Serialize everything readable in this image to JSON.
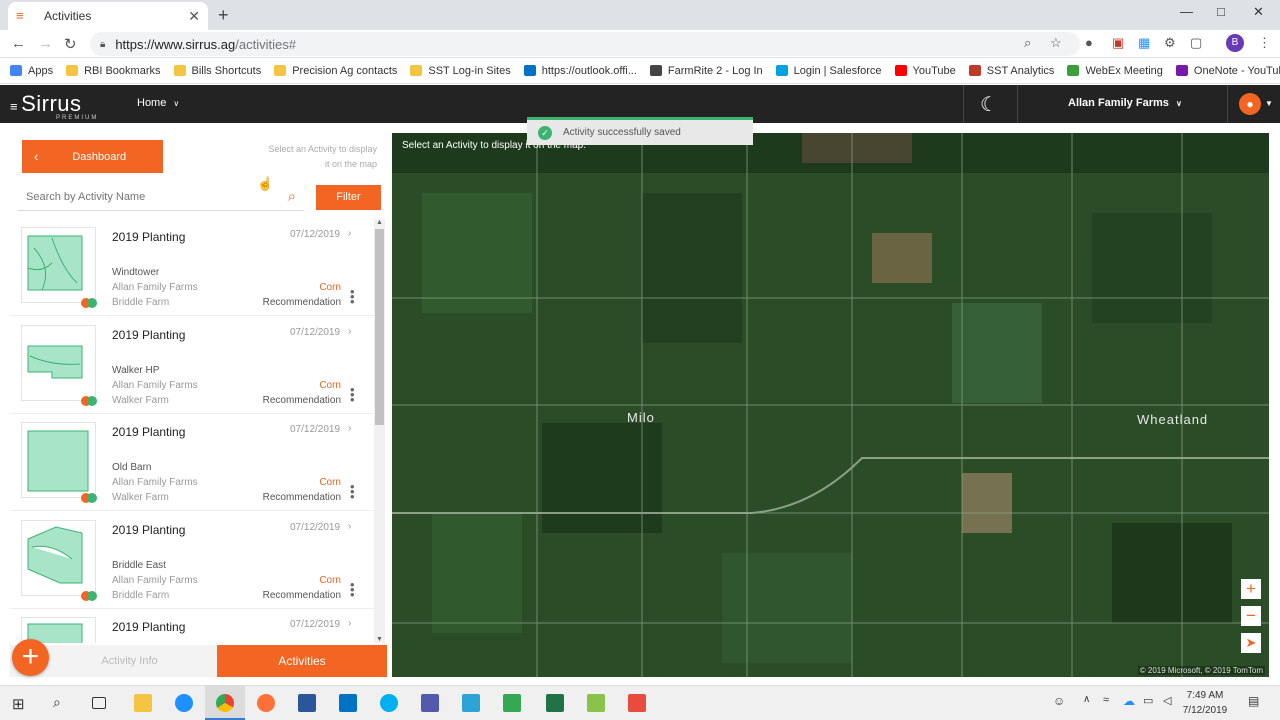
{
  "browser": {
    "tab_title": "Activities",
    "url_host": "https://www.sirrus.ag",
    "url_path": "/activities#",
    "profile_initial": "B",
    "bookmarks": [
      {
        "label": "Apps",
        "color": "#4285f4"
      },
      {
        "label": "RBI Bookmarks",
        "color": "#f4c542"
      },
      {
        "label": "Bills Shortcuts",
        "color": "#f4c542"
      },
      {
        "label": "Precision Ag contacts",
        "color": "#f4c542"
      },
      {
        "label": "SST Log-in Sites",
        "color": "#f4c542"
      },
      {
        "label": "https://outlook.offi...",
        "color": "#0072c6"
      },
      {
        "label": "FarmRite 2 - Log In",
        "color": "#444444"
      },
      {
        "label": "Login | Salesforce",
        "color": "#00a1e0"
      },
      {
        "label": "YouTube",
        "color": "#ff0000"
      },
      {
        "label": "SST Analytics",
        "color": "#c0392b"
      },
      {
        "label": "WebEx Meeting",
        "color": "#3aa13a"
      },
      {
        "label": "OneNote - YouTub...",
        "color": "#7719aa"
      }
    ]
  },
  "app": {
    "logo": "Sirrus",
    "logo_sub": "PREMIUM",
    "nav_home": "Home",
    "farm": "Allan Family Farms"
  },
  "panel": {
    "dashboard": "Dashboard",
    "hint": "Select an Activity to display it on the map",
    "search_placeholder": "Search by Activity Name",
    "filter": "Filter",
    "tab_info": "Activity Info",
    "tab_activities": "Activities"
  },
  "activities": [
    {
      "title": "2019 Planting",
      "date": "07/12/2019",
      "field": "Windtower",
      "farm": "Allan Family Farms",
      "sub_farm": "Briddle Farm",
      "crop": "Corn",
      "type": "Recommendation"
    },
    {
      "title": "2019 Planting",
      "date": "07/12/2019",
      "field": "Walker HP",
      "farm": "Allan Family Farms",
      "sub_farm": "Walker Farm",
      "crop": "Corn",
      "type": "Recommendation"
    },
    {
      "title": "2019 Planting",
      "date": "07/12/2019",
      "field": "Old Barn",
      "farm": "Allan Family Farms",
      "sub_farm": "Walker Farm",
      "crop": "Corn",
      "type": "Recommendation"
    },
    {
      "title": "2019 Planting",
      "date": "07/12/2019",
      "field": "Briddle East",
      "farm": "Allan Family Farms",
      "sub_farm": "Briddle Farm",
      "crop": "Corn",
      "type": "Recommendation"
    },
    {
      "title": "2019 Planting",
      "date": "07/12/2019",
      "field": "",
      "farm": "",
      "sub_farm": "",
      "crop": "",
      "type": ""
    }
  ],
  "map": {
    "hint": "Select an Activity to display it on the map.",
    "town1": "Milo",
    "town2": "Wheatland",
    "attribution": "© 2019 Microsoft, © 2019 TomTom"
  },
  "toast": "Activity successfully saved",
  "taskbar": {
    "time": "7:49 AM",
    "date": "7/12/2019"
  }
}
